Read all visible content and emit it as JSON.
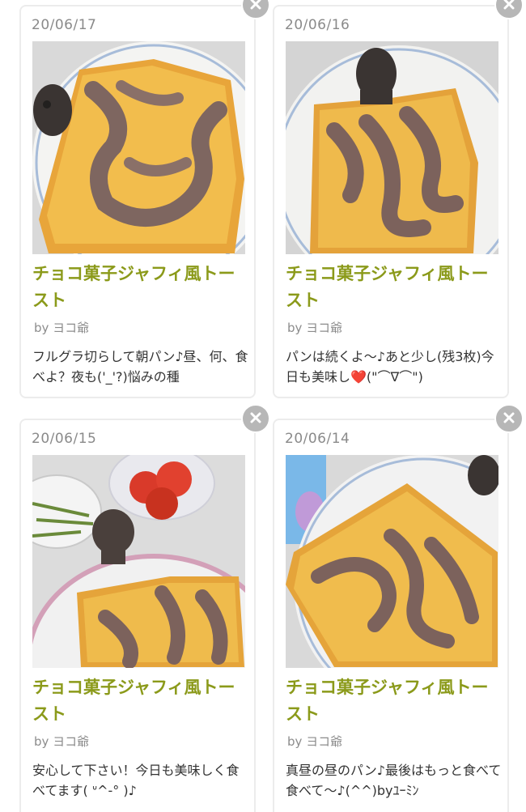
{
  "recipes": [
    {
      "date": "20/06/17",
      "title": "チョコ菓子ジャフィ風トースト",
      "author": "by ヨコ爺",
      "description": "フルグラ切らして朝パン♪昼、何、食べよ？夜も('_'?)悩みの種",
      "image_icon": "toast-photo"
    },
    {
      "date": "20/06/16",
      "title": "チョコ菓子ジャフィ風トースト",
      "author": "by ヨコ爺",
      "description": "パンは続くよ〜♪あと少し(残3枚)今日も美味し❤️(\"⌒∇⌒\")",
      "image_icon": "toast-photo"
    },
    {
      "date": "20/06/15",
      "title": "チョコ菓子ジャフィ風トースト",
      "author": "by ヨコ爺",
      "description": "安心して下さい！今日も美味しく食べてます( ᐡ^-° )♪",
      "image_icon": "toast-photo"
    },
    {
      "date": "20/06/14",
      "title": "チョコ菓子ジャフィ風トースト",
      "author": "by ヨコ爺",
      "description": "真昼の昼のパン♪最後はもっと食べて食べて〜♪(^^)byﾕｰﾐﾝ",
      "image_icon": "toast-photo"
    }
  ],
  "close_icon": "close-icon",
  "colors": {
    "title_green": "#8b9a1a",
    "date_gray": "#8a8a8a",
    "close_gray": "#b7b7b7"
  }
}
